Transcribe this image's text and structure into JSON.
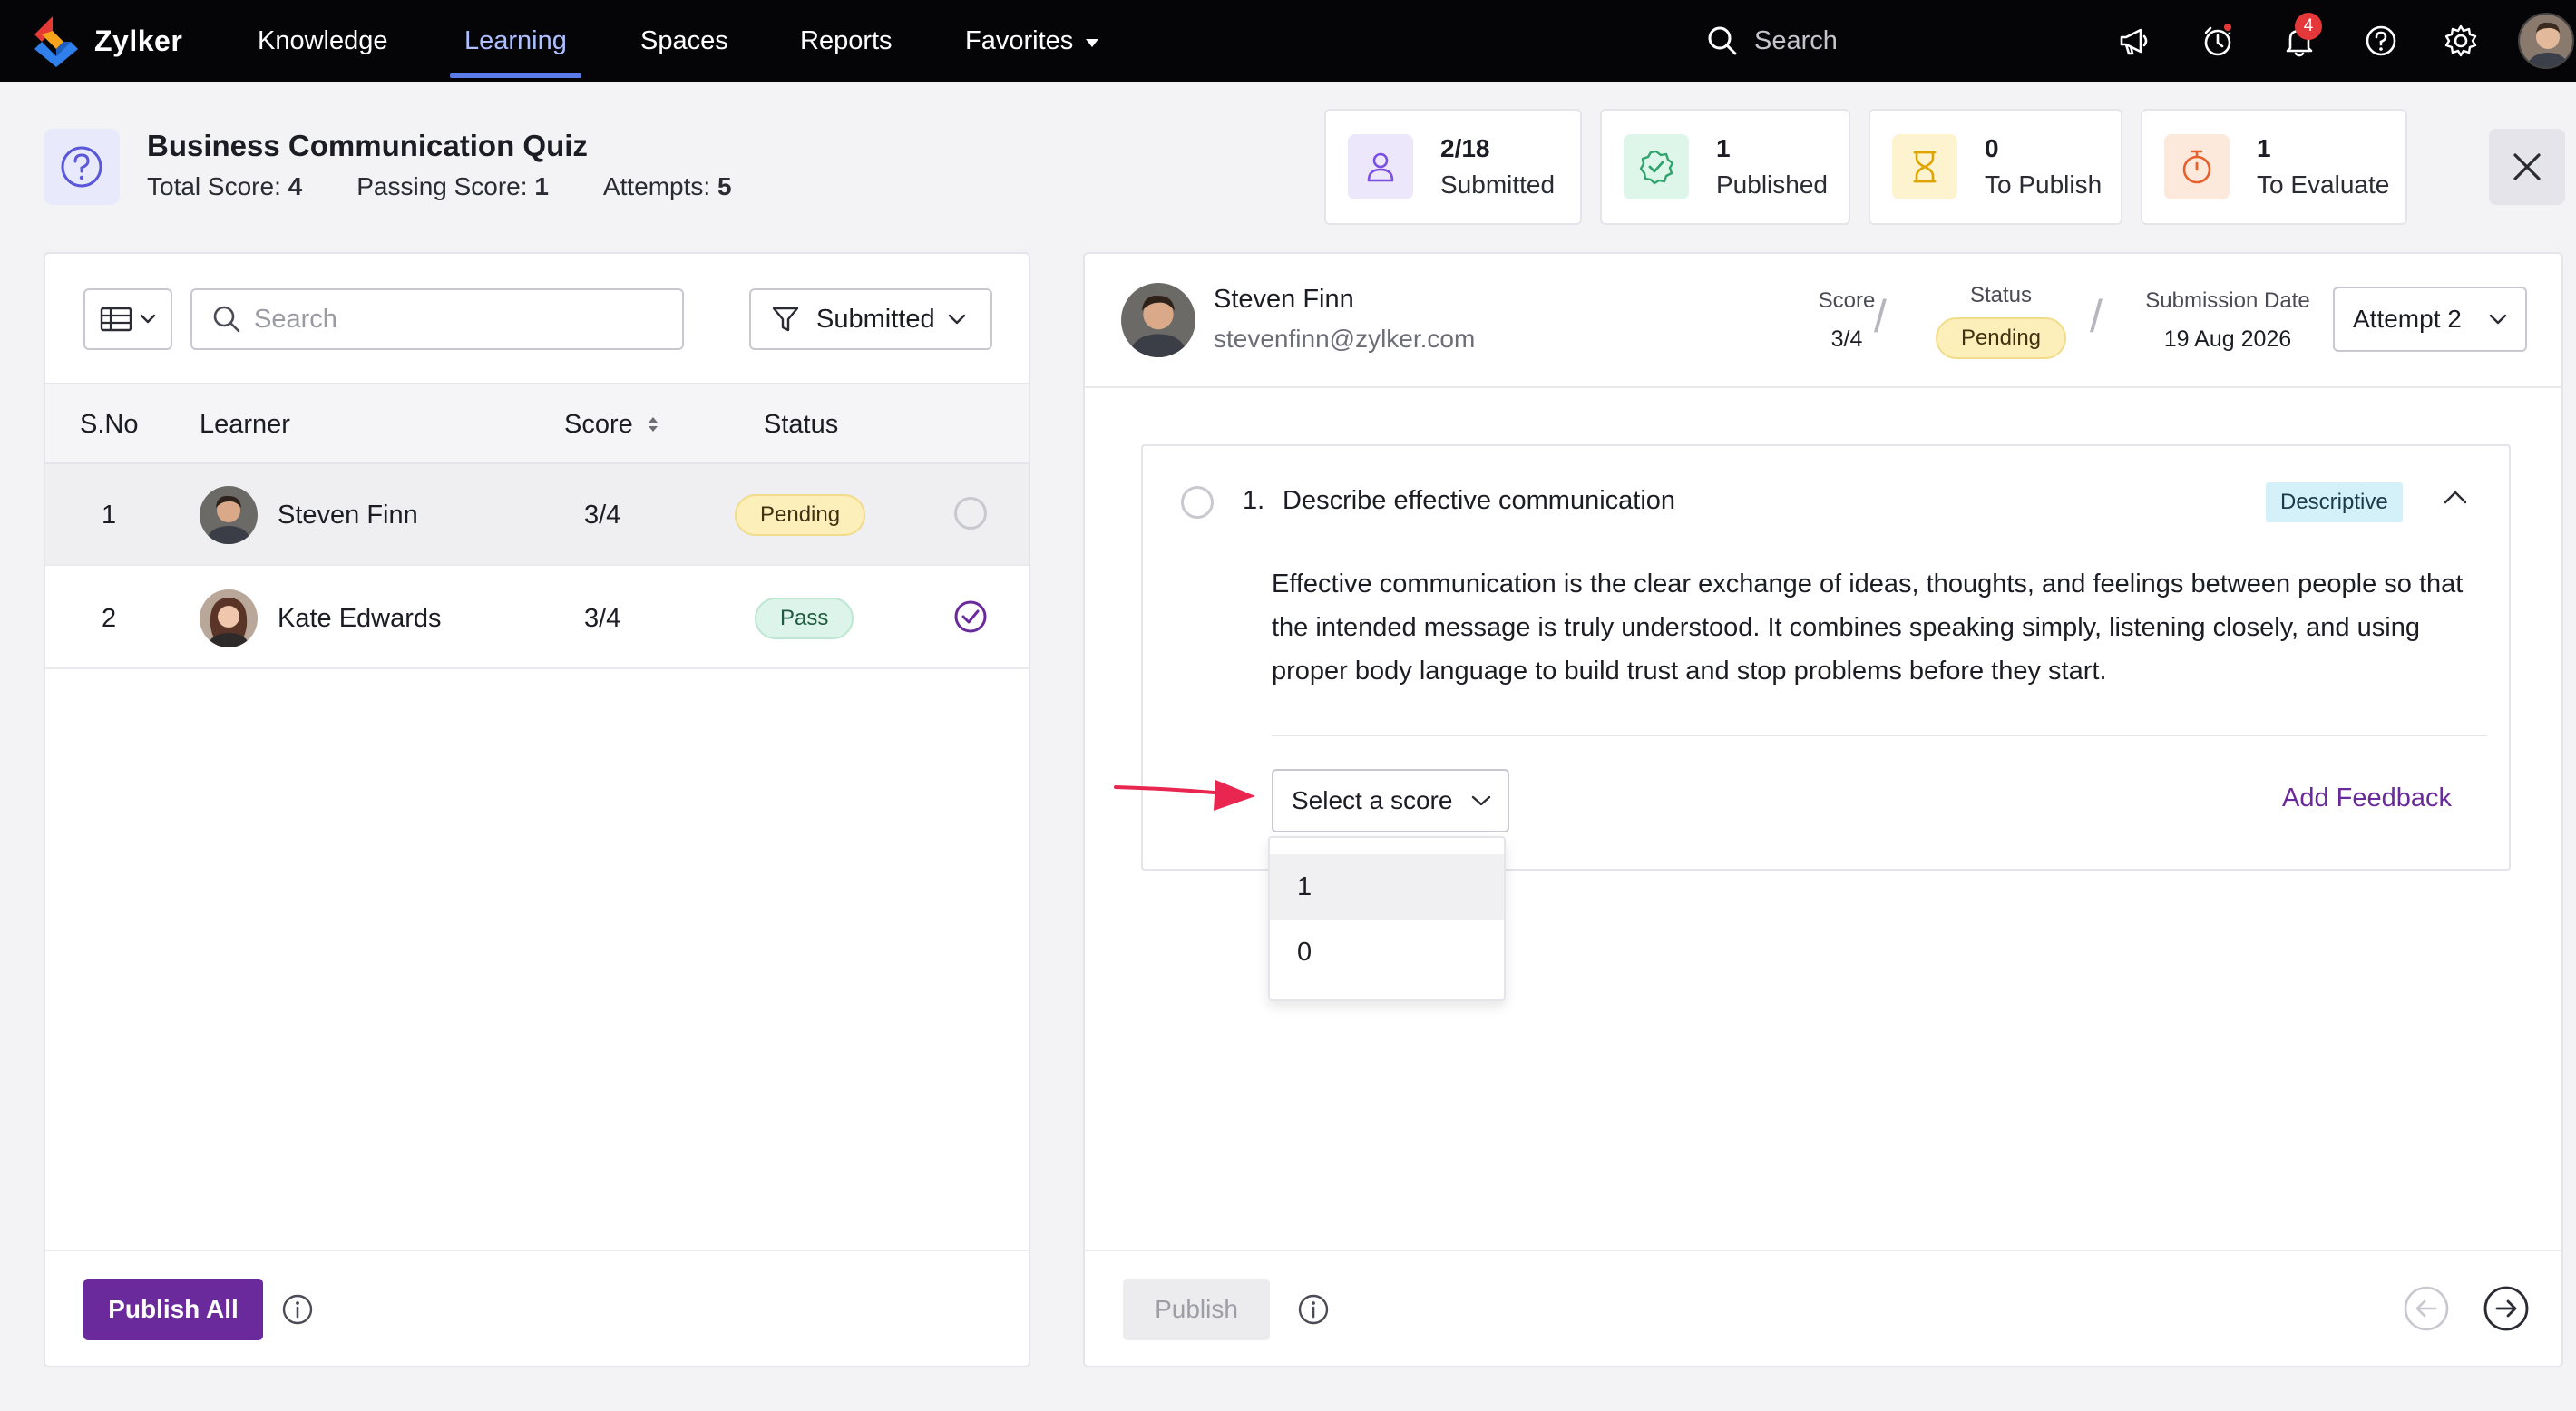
{
  "nav": {
    "brand": "Zylker",
    "items": [
      {
        "label": "Knowledge"
      },
      {
        "label": "Learning"
      },
      {
        "label": "Spaces"
      },
      {
        "label": "Reports"
      },
      {
        "label": "Favorites"
      }
    ],
    "active": "Learning",
    "search_placeholder": "Search",
    "notification_count": "4",
    "icons": [
      "megaphone-icon",
      "timer-icon",
      "bell-icon",
      "help-icon",
      "gear-icon"
    ]
  },
  "quiz": {
    "title": "Business Communication Quiz",
    "total_score_label": "Total Score:",
    "total_score": "4",
    "passing_score_label": "Passing Score:",
    "passing_score": "1",
    "attempts_label": "Attempts:",
    "attempts": "5"
  },
  "stats": [
    {
      "num": "2/18",
      "label": "Submitted",
      "icon": "user-icon",
      "color": "#7b4fe0"
    },
    {
      "num": "1",
      "label": "Published",
      "icon": "check-badge-icon",
      "color": "#2fa36b"
    },
    {
      "num": "0",
      "label": "To Publish",
      "icon": "hourglass-icon",
      "color": "#e0a400"
    },
    {
      "num": "1",
      "label": "To Evaluate",
      "icon": "stopwatch-icon",
      "color": "#e8602c"
    }
  ],
  "list": {
    "search_placeholder": "Search",
    "filter_label": "Submitted",
    "columns": {
      "sno": "S.No",
      "learner": "Learner",
      "score": "Score",
      "status": "Status"
    },
    "rows": [
      {
        "sno": "1",
        "name": "Steven Finn",
        "score": "3/4",
        "status": "Pending"
      },
      {
        "sno": "2",
        "name": "Kate Edwards",
        "score": "3/4",
        "status": "Pass"
      }
    ],
    "publish_all_label": "Publish All"
  },
  "detail": {
    "learner_name": "Steven Finn",
    "learner_email": "stevenfinn@zylker.com",
    "score_label": "Score",
    "score_value": "3/4",
    "status_label": "Status",
    "status_value": "Pending",
    "date_label": "Submission Date",
    "date_value": "19 Aug 2026",
    "attempt_label": "Attempt 2",
    "question": {
      "number": "1.",
      "title": "Describe effective communication",
      "type": "Descriptive",
      "answer": "Effective communication is the clear exchange of ideas, thoughts, and feelings between people so that the intended message is truly understood. It combines speaking simply, listening closely, and using proper body language to build trust and stop problems before they start."
    },
    "score_select_placeholder": "Select a score",
    "score_options": [
      "1",
      "0"
    ],
    "add_feedback_label": "Add Feedback",
    "publish_label": "Publish"
  },
  "colors": {
    "accent": "#6a2a9c",
    "nav_bg": "#050507",
    "nav_active": "#aebfff",
    "annotation_arrow": "#e8264f"
  }
}
